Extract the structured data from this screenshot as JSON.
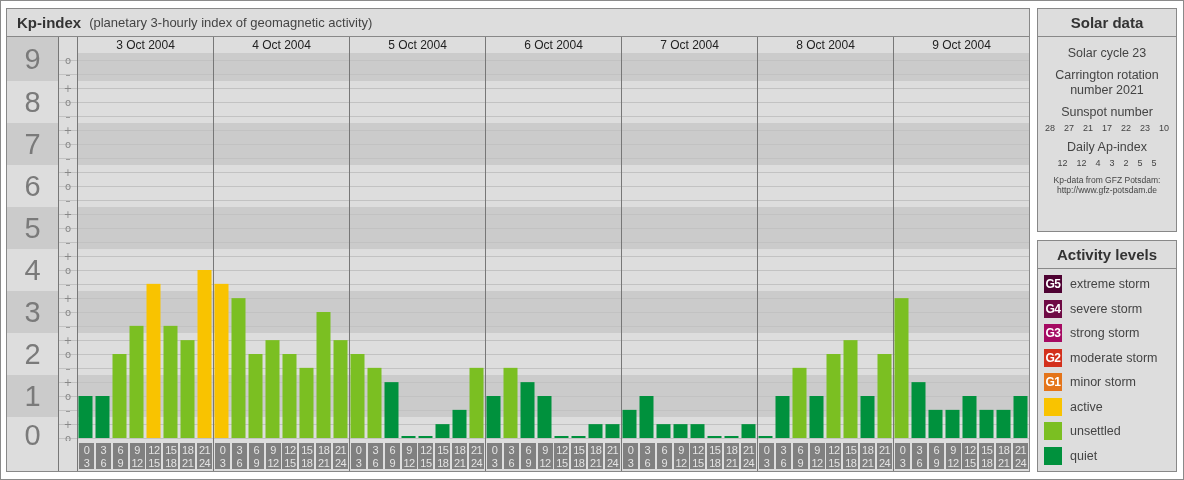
{
  "kp_panel": {
    "subtitle": "(planetary 3-hourly index of geomagnetic activity)",
    "days": [
      "3 Oct 2004",
      "4 Oct 2004",
      "5 Oct 2004",
      "6 Oct 2004",
      "7 Oct 2004",
      "8 Oct 2004",
      "9 Oct 2004"
    ],
    "sublevels": [
      "o",
      "–",
      "+",
      "o",
      "–",
      "+",
      "o",
      "–",
      "+",
      "o",
      "–",
      "+",
      "o",
      "–",
      "+",
      "o",
      "–",
      "+",
      "o",
      "–",
      "+",
      "o",
      "–",
      "+",
      "o",
      "–",
      "+",
      "o"
    ],
    "chart_data": {
      "type": "bar",
      "title": "Kp-index",
      "grid": true,
      "categories": [
        "0 3",
        "3 6",
        "6 9",
        "9 12",
        "12 15",
        "15 18",
        "18 21",
        "21 24",
        "0 3",
        "3 6",
        "6 9",
        "9 12",
        "12 15",
        "15 18",
        "18 21",
        "21 24",
        "0 3",
        "3 6",
        "6 9",
        "9 12",
        "12 15",
        "15 18",
        "18 21",
        "21 24",
        "0 3",
        "3 6",
        "6 9",
        "9 12",
        "12 15",
        "15 18",
        "18 21",
        "21 24",
        "0 3",
        "3 6",
        "6 9",
        "9 12",
        "12 15",
        "15 18",
        "18 21",
        "21 24",
        "0 3",
        "3 6",
        "6 9",
        "9 12",
        "12 15",
        "15 18",
        "18 21",
        "21 24",
        "0 3",
        "3 6",
        "6 9",
        "9 12",
        "12 15",
        "15 18",
        "18 21",
        "21 24"
      ],
      "ylim": [
        0,
        9
      ],
      "yticks": [
        {
          "value": 9,
          "label": "9"
        },
        {
          "value": 8,
          "label": "8"
        },
        {
          "value": 7,
          "label": "7"
        },
        {
          "value": 6,
          "label": "6"
        },
        {
          "value": 5,
          "label": "5"
        },
        {
          "value": 4,
          "label": "4"
        },
        {
          "value": 3,
          "label": "3"
        },
        {
          "value": 2,
          "label": "2"
        },
        {
          "value": 1,
          "label": "1"
        },
        {
          "value": 0,
          "label": "0"
        }
      ],
      "series": [
        {
          "name": "quiet",
          "color": "#00913d",
          "values": [
            1,
            1,
            null,
            null,
            null,
            null,
            null,
            null,
            null,
            null,
            null,
            null,
            null,
            null,
            null,
            null,
            null,
            null,
            1.33,
            0,
            0,
            0.33,
            0.67,
            null,
            1,
            null,
            1.33,
            1,
            0,
            0,
            0.33,
            0.33,
            0.67,
            1,
            0.33,
            0.33,
            0.33,
            0,
            0,
            0.33,
            0,
            1,
            null,
            1,
            null,
            null,
            1,
            null,
            null,
            1.33,
            0.67,
            0.67,
            1,
            0.67,
            0.67,
            1
          ]
        },
        {
          "name": "unsettled",
          "color": "#7bbf22",
          "values": [
            null,
            null,
            2,
            2.67,
            null,
            2.67,
            2.33,
            null,
            null,
            3.33,
            2,
            2.33,
            2,
            1.67,
            3,
            2.33,
            2,
            1.67,
            null,
            null,
            null,
            null,
            null,
            1.67,
            null,
            1.67,
            null,
            null,
            null,
            null,
            null,
            null,
            null,
            null,
            null,
            null,
            null,
            null,
            null,
            null,
            null,
            null,
            1.67,
            null,
            2,
            2.33,
            null,
            2,
            3.33,
            null,
            null,
            null,
            null,
            null,
            null,
            null
          ]
        },
        {
          "name": "active",
          "color": "#f9c300",
          "values": [
            null,
            null,
            null,
            null,
            3.67,
            null,
            null,
            4,
            3.67,
            null,
            null,
            null,
            null,
            null,
            null,
            null,
            null,
            null,
            null,
            null,
            null,
            null,
            null,
            null,
            null,
            null,
            null,
            null,
            null,
            null,
            null,
            null,
            null,
            null,
            null,
            null,
            null,
            null,
            null,
            null,
            null,
            null,
            null,
            null,
            null,
            null,
            null,
            null,
            null,
            null,
            null,
            null,
            null,
            null,
            null,
            null
          ]
        }
      ]
    }
  },
  "solar_data": {
    "title": "Solar data",
    "cycle": "Solar cycle 23",
    "carrington": "Carrington rotation number 2021",
    "sunspot_label": "Sunspot number",
    "sunspot_numbers": [
      "28",
      "27",
      "21",
      "17",
      "22",
      "23",
      "10"
    ],
    "ap_label": "Daily Ap-index",
    "ap_values": [
      "12",
      "12",
      "4",
      "3",
      "2",
      "5",
      "5"
    ],
    "source": [
      "Kp-data from GFZ Potsdam:",
      "http://www.gfz-potsdam.de"
    ]
  },
  "activity_levels": {
    "title": "Activity levels",
    "items": [
      {
        "kind": "storm",
        "badge": "G5",
        "label": "extreme storm",
        "color": "#4e0232"
      },
      {
        "kind": "storm",
        "badge": "G4",
        "label": "severe storm",
        "color": "#6e0a44"
      },
      {
        "kind": "storm",
        "badge": "G3",
        "label": "strong storm",
        "color": "#a50a62"
      },
      {
        "kind": "storm",
        "badge": "G2",
        "label": "moderate storm",
        "color": "#d3301c"
      },
      {
        "kind": "storm",
        "badge": "G1",
        "label": "minor storm",
        "color": "#e4741a"
      }
    ]
  }
}
